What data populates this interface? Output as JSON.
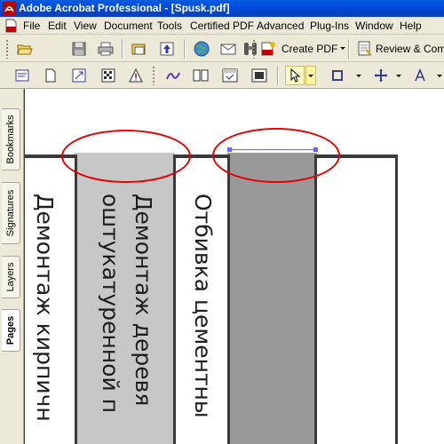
{
  "window": {
    "title": "Adobe Acrobat Professional - [Spusk.pdf]"
  },
  "menu": [
    "File",
    "Edit",
    "View",
    "Document",
    "Tools",
    "Certified PDF",
    "Advanced",
    "Plug-Ins",
    "Window",
    "Help"
  ],
  "toolbar": {
    "create_pdf_label": "Create PDF",
    "review_label": "Review & Comm"
  },
  "navigation_tabs": [
    "Bookmarks",
    "Signatures",
    "Layers",
    "Pages"
  ],
  "document": {
    "column_texts": [
      "Демонтаж кирпичн",
      "Демонтаж деревя",
      "оштукатуренной п",
      "Отбивка цементны"
    ]
  },
  "colors": {
    "annotation": "#e60000",
    "column_light": "#c7c7c7",
    "column_dark": "#999999",
    "selection": "#6666ff"
  },
  "icons": [
    "acrobat-app-icon",
    "pdf-document-icon",
    "open-icon",
    "save-icon",
    "print-icon",
    "organizer-icon",
    "upload-icon",
    "search-web-icon",
    "email-icon",
    "binoculars-icon",
    "create-pdf-icon",
    "dropdown-arrow-icon",
    "review-icon",
    "hand-tool-icon",
    "select-tool-icon",
    "crop-icon",
    "zoom-icon",
    "text-icon"
  ]
}
